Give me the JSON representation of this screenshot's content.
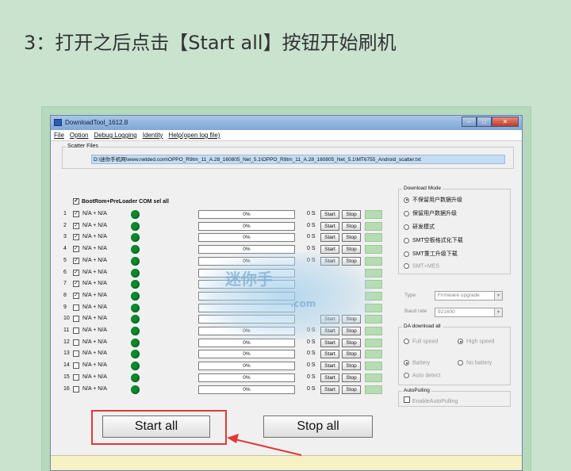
{
  "heading": "3：打开之后点击【Start all】按钮开始刷机",
  "window": {
    "title": "DownloadTool_1612.8",
    "controls": [
      "–",
      "□",
      "✕"
    ]
  },
  "menu": [
    "File",
    "Option",
    "Debug Logging",
    "Identity",
    "Help(open log file)"
  ],
  "scatter": {
    "label": "Scatter Files",
    "path": "D:\\迷你手机网\\www.netded.com\\OPPO_R9tm_11_A.28_160805_Net_5.1\\OPPO_R9tm_11_A.28_160805_Net_5.1\\MT6755_Android_scatter.txt"
  },
  "select_all": {
    "checked": true,
    "label": "BootRom+PreLoader COM sel all"
  },
  "ports": [
    {
      "num": "1",
      "checked": true,
      "name": "N/A + N/A",
      "percent": "0%",
      "time": "0 S",
      "start": "Start",
      "stop": "Stop"
    },
    {
      "num": "2",
      "checked": true,
      "name": "N/A + N/A",
      "percent": "0%",
      "time": "0 S",
      "start": "Start",
      "stop": "Stop"
    },
    {
      "num": "3",
      "checked": true,
      "name": "N/A + N/A",
      "percent": "0%",
      "time": "0 S",
      "start": "Start",
      "stop": "Stop"
    },
    {
      "num": "4",
      "checked": true,
      "name": "N/A + N/A",
      "percent": "0%",
      "time": "0 S",
      "start": "Start",
      "stop": "Stop"
    },
    {
      "num": "5",
      "checked": true,
      "name": "N/A + N/A",
      "percent": "0%",
      "time": "0 S",
      "start": "Start",
      "stop": "Stop"
    },
    {
      "num": "6",
      "checked": true,
      "name": "N/A + N/A",
      "percent": "",
      "time": "",
      "start": "",
      "stop": ""
    },
    {
      "num": "7",
      "checked": true,
      "name": "N/A + N/A",
      "percent": "",
      "time": "",
      "start": "",
      "stop": ""
    },
    {
      "num": "8",
      "checked": true,
      "name": "N/A + N/A",
      "percent": "",
      "time": "",
      "start": "",
      "stop": ""
    },
    {
      "num": "9",
      "checked": false,
      "name": "N/A + N/A",
      "percent": "",
      "time": "",
      "start": "",
      "stop": ""
    },
    {
      "num": "10",
      "checked": false,
      "name": "N/A + N/A",
      "percent": "",
      "time": "",
      "start": "Start",
      "stop": "Stop"
    },
    {
      "num": "11",
      "checked": false,
      "name": "N/A + N/A",
      "percent": "0%",
      "time": "0 S",
      "start": "Start",
      "stop": "Stop"
    },
    {
      "num": "12",
      "checked": false,
      "name": "N/A + N/A",
      "percent": "0%",
      "time": "0 S",
      "start": "Start",
      "stop": "Stop"
    },
    {
      "num": "13",
      "checked": false,
      "name": "N/A + N/A",
      "percent": "0%",
      "time": "0 S",
      "start": "Start",
      "stop": "Stop"
    },
    {
      "num": "14",
      "checked": false,
      "name": "N/A + N/A",
      "percent": "0%",
      "time": "0 S",
      "start": "Start",
      "stop": "Stop"
    },
    {
      "num": "15",
      "checked": false,
      "name": "N/A + N/A",
      "percent": "0%",
      "time": "0 S",
      "start": "Start",
      "stop": "Stop"
    },
    {
      "num": "16",
      "checked": false,
      "name": "N/A + N/A",
      "percent": "0%",
      "time": "0 S",
      "start": "Start",
      "stop": "Stop"
    }
  ],
  "download_mode": {
    "title": "Download Mode",
    "options": [
      {
        "label": "不保留用户数据升级",
        "selected": true
      },
      {
        "label": "保留用户数据升级",
        "selected": false
      },
      {
        "label": "研发模式",
        "selected": false
      },
      {
        "label": "SMT空板格式化下载",
        "selected": false
      },
      {
        "label": "SMT重工升级下载",
        "selected": false
      },
      {
        "label": "SMT+MES",
        "selected": false
      }
    ]
  },
  "type_combo": {
    "label": "Type",
    "value": "Firmware upgrade"
  },
  "baud_combo": {
    "label": "Baud rate",
    "value": "921600"
  },
  "da_download": {
    "title": "DA download all",
    "full_speed": "Full speed",
    "high_speed": "High speed",
    "battery": "Battery",
    "no_battery": "No battery",
    "auto_detect": "Auto detect"
  },
  "auto_pulling": {
    "title": "AutoPulling",
    "label": "EnableAutoPulling"
  },
  "buttons": {
    "start_all": "Start all",
    "stop_all": "Stop all"
  },
  "watermark": {
    "line1": "迷你手",
    "line2": ".com"
  },
  "colors": {
    "annotation": "#e0393a",
    "port_status_dot": "#0c8a2e",
    "background": "#c9e3cf"
  }
}
